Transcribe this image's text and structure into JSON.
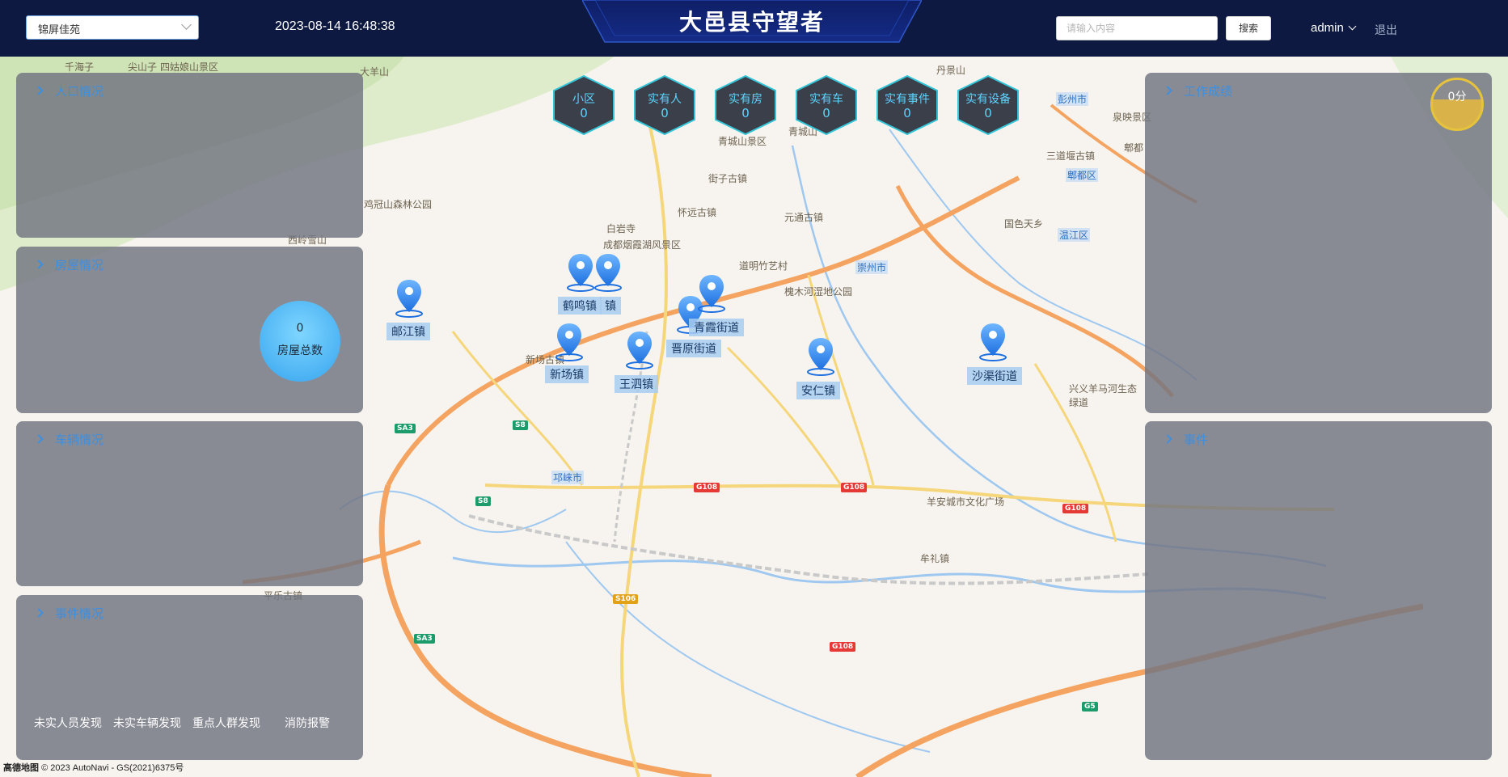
{
  "header": {
    "community_select": "锦屏佳苑",
    "datetime": "2023-08-14 16:48:38",
    "title": "大邑县守望者",
    "search_placeholder": "请输入内容",
    "search_button": "搜索",
    "user": "admin",
    "logout": "退出"
  },
  "stats": [
    {
      "label": "小区",
      "value": "0"
    },
    {
      "label": "实有人",
      "value": "0"
    },
    {
      "label": "实有房",
      "value": "0"
    },
    {
      "label": "实有车",
      "value": "0"
    },
    {
      "label": "实有事件",
      "value": "0"
    },
    {
      "label": "实有设备",
      "value": "0"
    }
  ],
  "left_panels": {
    "population": "人口情况",
    "housing": "房屋情况",
    "vehicles": "车辆情况",
    "events": "事件情况"
  },
  "housing_total": {
    "value": "0",
    "label": "房屋总数"
  },
  "event_links": [
    "未实人员发现",
    "未实车辆发现",
    "重点人群发现",
    "消防报警"
  ],
  "right_panels": {
    "work_score": "工作成绩",
    "events": "事件"
  },
  "score": "0分",
  "markers": [
    "邮江镇",
    "鹤鸣镇",
    "镇",
    "新场镇",
    "王泗镇",
    "晋原街道",
    "青霞街道",
    "安仁镇",
    "沙渠街道"
  ],
  "map_labels": {
    "labels": [
      "千海子",
      "尖山子",
      "四姑娘山景区",
      "大羊山",
      "丹景山",
      "青城山景区",
      "青城山",
      "街子古镇",
      "怀远古镇",
      "白岩寺",
      "成都烟霞湖风景区",
      "元通古镇",
      "道明竹艺村",
      "崇州市",
      "槐木河湿地公园",
      "鸡冠山森林公园",
      "西岭雪山",
      "新场古镇",
      "邛崃市",
      "羊安城市文化广场",
      "牟礼镇",
      "平乐古镇",
      "郫都区",
      "三道堰古镇",
      "郫都",
      "温江区",
      "国色天乡",
      "兴义羊马河生态绿道",
      "彭州市",
      "泉映景区"
    ],
    "shields": [
      "SA3",
      "S8",
      "S8",
      "G108",
      "G108",
      "G108",
      "S106",
      "SA3",
      "G108",
      "G5"
    ]
  },
  "footer": {
    "logo": "高德地图",
    "copyright": "© 2023 AutoNavi - GS(2021)6375号"
  },
  "colors": {
    "header_bg": "#0d1940",
    "panel_bg": "#707480",
    "accent_blue": "#3c8fe0",
    "stat_text": "#5ed4ff",
    "score_gold": "#e7c33c"
  }
}
